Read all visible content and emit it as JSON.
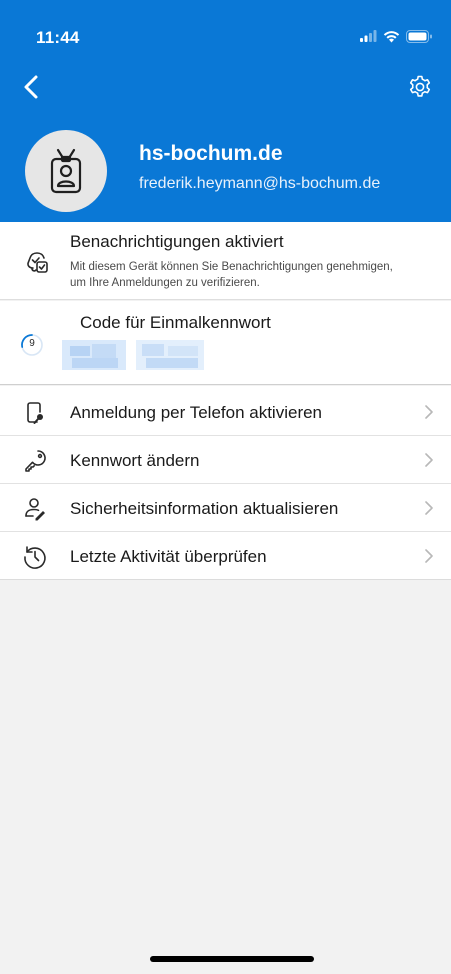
{
  "status_bar": {
    "time": "11:44"
  },
  "header": {
    "org_name": "hs-bochum.de",
    "email": "frederik.heymann@hs-bochum.de",
    "back_icon": "chevron-left-icon",
    "settings_icon": "gear-icon",
    "avatar_icon": "id-badge-icon",
    "background_color": "#0a78d6"
  },
  "notifications": {
    "title": "Benachrichtigungen aktiviert",
    "subtitle": "Mit diesem Gerät können Sie Benachrichtigungen genehmigen, um Ihre Anmeldungen zu verifizieren."
  },
  "otp": {
    "title": "Code für Einmalkennwort",
    "timer_value": "9"
  },
  "menu": {
    "items": [
      {
        "label": "Anmeldung per Telefon aktivieren",
        "icon": "phone-key-icon"
      },
      {
        "label": "Kennwort ändern",
        "icon": "key-icon"
      },
      {
        "label": "Sicherheitsinformation aktualisieren",
        "icon": "user-edit-icon"
      },
      {
        "label": "Letzte Aktivität überprüfen",
        "icon": "history-icon"
      }
    ]
  }
}
